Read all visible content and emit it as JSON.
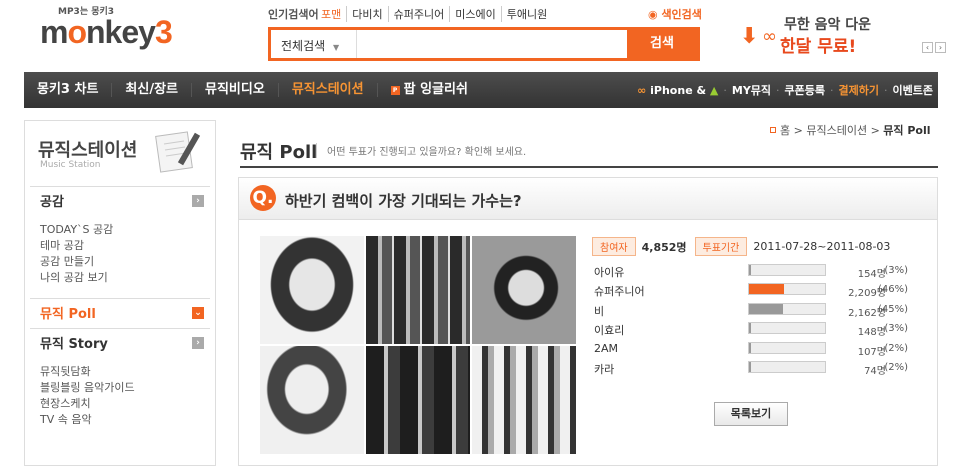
{
  "header": {
    "logo_sub": "MP3는 몽키3",
    "logo_text": "monkey3",
    "hot_label": "인기검색어",
    "hot_keywords": [
      "포맨",
      "다비치",
      "슈퍼주니어",
      "미스에이",
      "투애니원"
    ],
    "color_search": "색인검색",
    "search_scope": "전체검색",
    "search_placeholder": "",
    "search_button": "검색",
    "ad_line1": "무한 음악 다운",
    "ad_line2": "한달 무료!"
  },
  "nav": {
    "left": [
      "몽키3 차트",
      "최신/장르",
      "뮤직비디오",
      "뮤직스테이션",
      "팝 잉글리쉬"
    ],
    "active_index": 3,
    "right": [
      "iPhone &",
      "MY뮤직",
      "쿠폰등록",
      "결제하기",
      "이벤트존"
    ]
  },
  "sidebar": {
    "title": "뮤직스테이션",
    "subtitle": "Music Station",
    "sections": [
      {
        "label": "공감",
        "items": [
          "TODAY`S 공감",
          "테마 공감",
          "공감 만들기",
          "나의 공감 보기"
        ]
      },
      {
        "label": "뮤직 Poll",
        "items": []
      },
      {
        "label": "뮤직 Story",
        "items": [
          "뮤직뒷담화",
          "블링블링 음악가이드",
          "현장스케치",
          "TV 속 음악"
        ]
      }
    ]
  },
  "breadcrumb": {
    "home": "홈",
    "section": "뮤직스테이션",
    "current": "뮤직 Poll"
  },
  "page": {
    "title": "뮤직 Poll",
    "description": "어떤 투표가 진행되고 있을까요? 확인해 보세요."
  },
  "poll": {
    "q_mark": "Q.",
    "question": "하반기 컴백이 가장 기대되는 가수는?",
    "participants_label": "참여자",
    "participants": "4,852명",
    "period_label": "투표기간",
    "period": "2011-07-28~2011-08-03",
    "options": [
      {
        "name": "아이유",
        "count": "154명",
        "percent": "(3%)",
        "ratio": 0.03,
        "color": "#999999"
      },
      {
        "name": "슈퍼주니어",
        "count": "2,209명",
        "percent": "(46%)",
        "ratio": 0.46,
        "color": "#f26522"
      },
      {
        "name": "비",
        "count": "2,162명",
        "percent": "(45%)",
        "ratio": 0.45,
        "color": "#999999"
      },
      {
        "name": "이효리",
        "count": "148명",
        "percent": "(3%)",
        "ratio": 0.03,
        "color": "#999999"
      },
      {
        "name": "2AM",
        "count": "107명",
        "percent": "(2%)",
        "ratio": 0.02,
        "color": "#999999"
      },
      {
        "name": "카라",
        "count": "74명",
        "percent": "(2%)",
        "ratio": 0.02,
        "color": "#999999"
      }
    ],
    "list_button": "목록보기"
  }
}
